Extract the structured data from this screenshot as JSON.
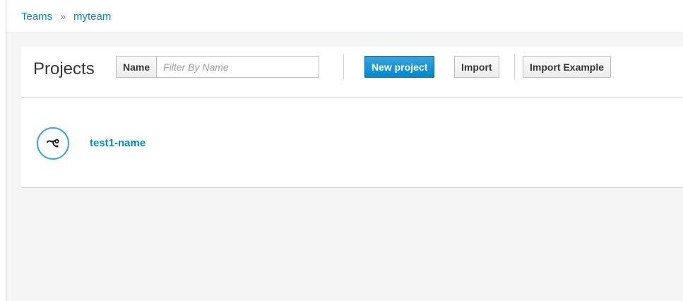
{
  "breadcrumb": {
    "items": [
      {
        "label": "Teams"
      },
      {
        "label": "myteam"
      }
    ],
    "separator": "»"
  },
  "toolbar": {
    "title": "Projects",
    "filter": {
      "field_label": "Name",
      "placeholder": "Filter By Name",
      "value": ""
    },
    "new_project_label": "New project",
    "import_label": "Import",
    "import_example_label": "Import Example"
  },
  "projects": [
    {
      "name": "test1-name",
      "icon": "code-branch-icon"
    }
  ],
  "colors": {
    "accent": "#0088ce",
    "icon_ring": "#39a5dc",
    "background": "#f5f5f5"
  }
}
